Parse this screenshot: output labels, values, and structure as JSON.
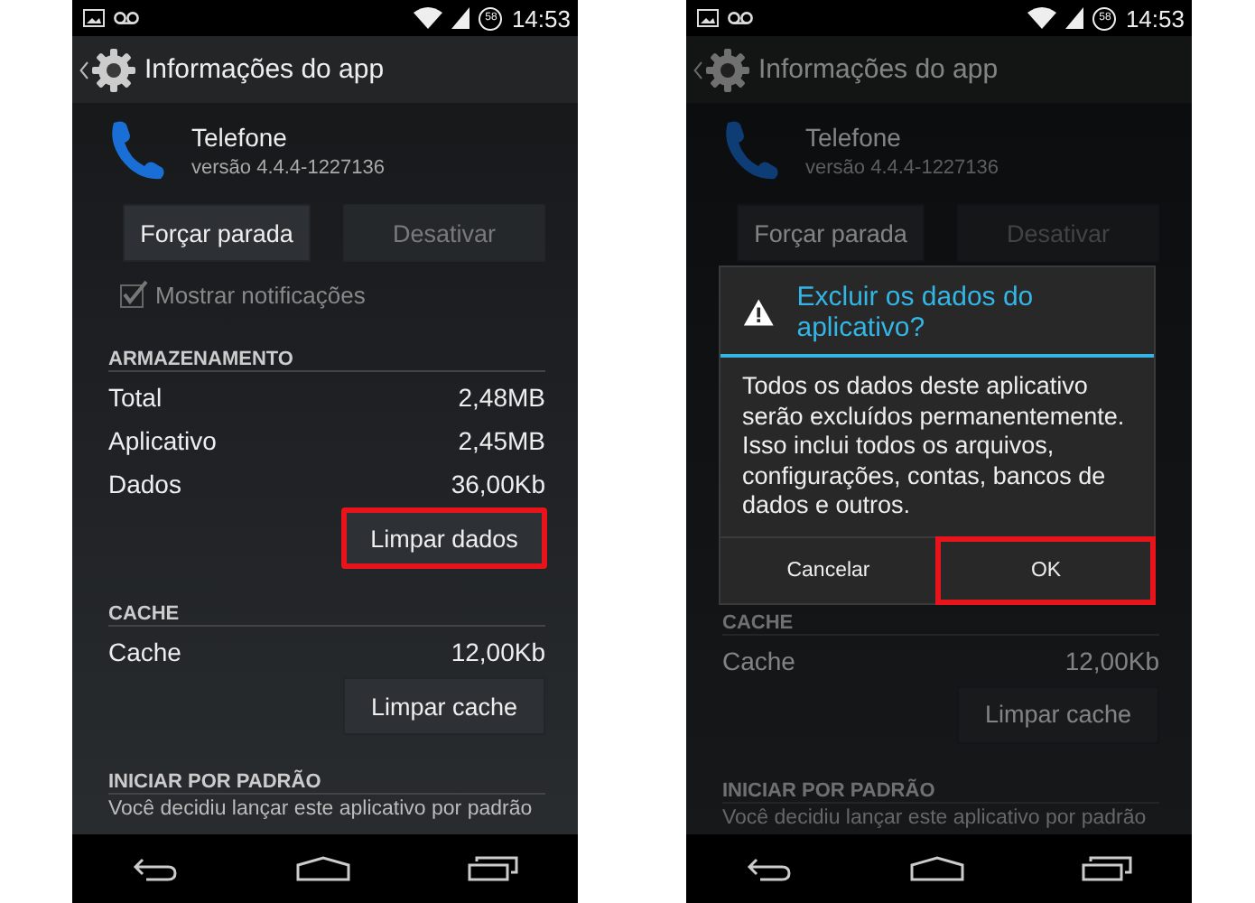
{
  "phones": [
    {
      "status_bar": {
        "badge": "58",
        "time": "14:53"
      },
      "action_bar": {
        "title": "Informações do app"
      },
      "app": {
        "name": "Telefone",
        "version": "versão 4.4.4-1227136"
      },
      "buttons": [
        {
          "label": "Forçar parada",
          "disabled": false
        },
        {
          "label": "Desativar",
          "disabled": true
        }
      ],
      "notifications": {
        "label": "Mostrar notificações",
        "checked": true,
        "disabled": true
      },
      "sections": [
        {
          "heading": "ARMAZENAMENTO",
          "rows": [
            {
              "label": "Total",
              "value": "2,48MB"
            },
            {
              "label": "Aplicativo",
              "value": "2,45MB"
            },
            {
              "label": "Dados",
              "value": "36,00Kb"
            }
          ],
          "button": {
            "label": "Limpar dados",
            "highlighted": true
          }
        },
        {
          "heading": "CACHE",
          "rows": [
            {
              "label": "Cache",
              "value": "12,00Kb"
            }
          ],
          "button": {
            "label": "Limpar cache",
            "highlighted": false
          }
        },
        {
          "heading": "INICIAR POR PADRÃO",
          "text": "Você decidiu lançar este aplicativo por padrão"
        }
      ]
    },
    {
      "status_bar": {
        "badge": "58",
        "time": "14:53"
      },
      "action_bar": {
        "title": "Informações do app"
      },
      "app": {
        "name": "Telefone",
        "version": "versão 4.4.4-1227136"
      },
      "buttons": [
        {
          "label": "Forçar parada",
          "disabled": false
        },
        {
          "label": "Desativar",
          "disabled": true
        }
      ],
      "dialog": {
        "title": "Excluir os dados do aplicativo?",
        "body": "Todos os dados deste aplicativo serão excluídos permanentemente. Isso inclui todos os arquivos, configurações, contas, bancos de dados e outros.",
        "buttons": [
          {
            "label": "Cancelar",
            "highlighted": false
          },
          {
            "label": "OK",
            "highlighted": true
          }
        ]
      },
      "sections": [
        {
          "heading": "CACHE",
          "rows": [
            {
              "label": "Cache",
              "value": "12,00Kb"
            }
          ],
          "button": {
            "label": "Limpar cache",
            "highlighted": false
          }
        },
        {
          "heading": "INICIAR POR PADRÃO",
          "text": "Você decidiu lançar este aplicativo por padrão"
        }
      ]
    }
  ]
}
